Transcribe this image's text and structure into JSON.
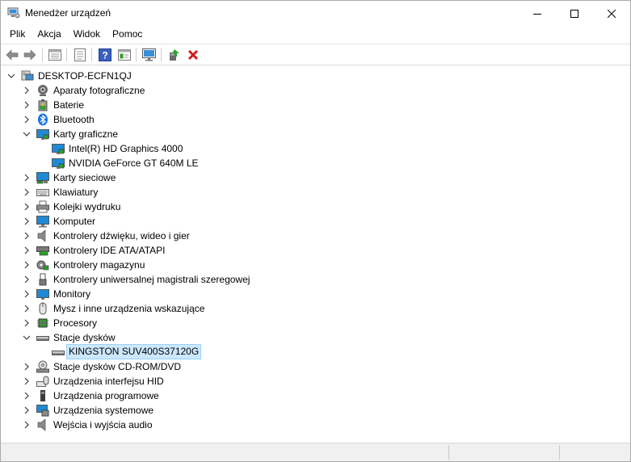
{
  "window": {
    "title": "Menedżer urządzeń",
    "icon": "device-manager-icon",
    "controls": [
      "minimize-icon",
      "maximize-icon",
      "close-icon"
    ]
  },
  "menu": {
    "items": [
      "Plik",
      "Akcja",
      "Widok",
      "Pomoc"
    ]
  },
  "toolbar": {
    "buttons": [
      "back-arrow-icon",
      "forward-arrow-icon",
      "properties-view-icon",
      "properties-sheet-icon",
      "help-icon",
      "resource-view-icon",
      "monitor-scan-icon",
      "update-driver-icon",
      "uninstall-device-icon"
    ],
    "accent_green": "#2e9e2e",
    "accent_red": "#d41a1a"
  },
  "tree": {
    "root": "DESKTOP-ECFN1QJ",
    "items": [
      {
        "label": "Aparaty fotograficzne",
        "icon": "camera-icon",
        "expanded": false
      },
      {
        "label": "Baterie",
        "icon": "battery-icon",
        "expanded": false
      },
      {
        "label": "Bluetooth",
        "icon": "bluetooth-icon",
        "expanded": false
      },
      {
        "label": "Karty graficzne",
        "icon": "display-adapter-icon",
        "expanded": true,
        "children": [
          "Intel(R) HD Graphics 4000",
          "NVIDIA GeForce GT 640M LE"
        ]
      },
      {
        "label": "Karty sieciowe",
        "icon": "network-adapter-icon",
        "expanded": false
      },
      {
        "label": "Klawiatury",
        "icon": "keyboard-icon",
        "expanded": false
      },
      {
        "label": "Kolejki wydruku",
        "icon": "print-queue-icon",
        "expanded": false
      },
      {
        "label": "Komputer",
        "icon": "computer-icon",
        "expanded": false
      },
      {
        "label": "Kontrolery dźwięku, wideo i gier",
        "icon": "speaker-icon",
        "expanded": false
      },
      {
        "label": "Kontrolery IDE ATA/ATAPI",
        "icon": "ide-controller-icon",
        "expanded": false
      },
      {
        "label": "Kontrolery magazynu",
        "icon": "storage-controller-icon",
        "expanded": false
      },
      {
        "label": "Kontrolery uniwersalnej magistrali szeregowej",
        "icon": "usb-icon",
        "expanded": false
      },
      {
        "label": "Monitory",
        "icon": "monitor-icon",
        "expanded": false
      },
      {
        "label": "Mysz i inne urządzenia wskazujące",
        "icon": "mouse-icon",
        "expanded": false
      },
      {
        "label": "Procesory",
        "icon": "processor-icon",
        "expanded": false
      },
      {
        "label": "Stacje dysków",
        "icon": "disk-drive-icon",
        "expanded": true,
        "children": [
          "KINGSTON SUV400S37120G"
        ]
      },
      {
        "label": "Stacje dysków CD-ROM/DVD",
        "icon": "cdrom-icon",
        "expanded": false
      },
      {
        "label": "Urządzenia interfejsu HID",
        "icon": "hid-icon",
        "expanded": false
      },
      {
        "label": "Urządzenia programowe",
        "icon": "software-device-icon",
        "expanded": false
      },
      {
        "label": "Urządzenia systemowe",
        "icon": "system-device-icon",
        "expanded": false
      },
      {
        "label": "Wejścia i wyjścia audio",
        "icon": "audio-io-icon",
        "expanded": false
      }
    ],
    "selected": "KINGSTON SUV400S37120G"
  },
  "colors": {
    "selection_bg": "#cce8ff",
    "selection_border": "#99d1ff",
    "monitor_blue": "#1e8ad6",
    "bluetooth_blue": "#1a73e8"
  }
}
